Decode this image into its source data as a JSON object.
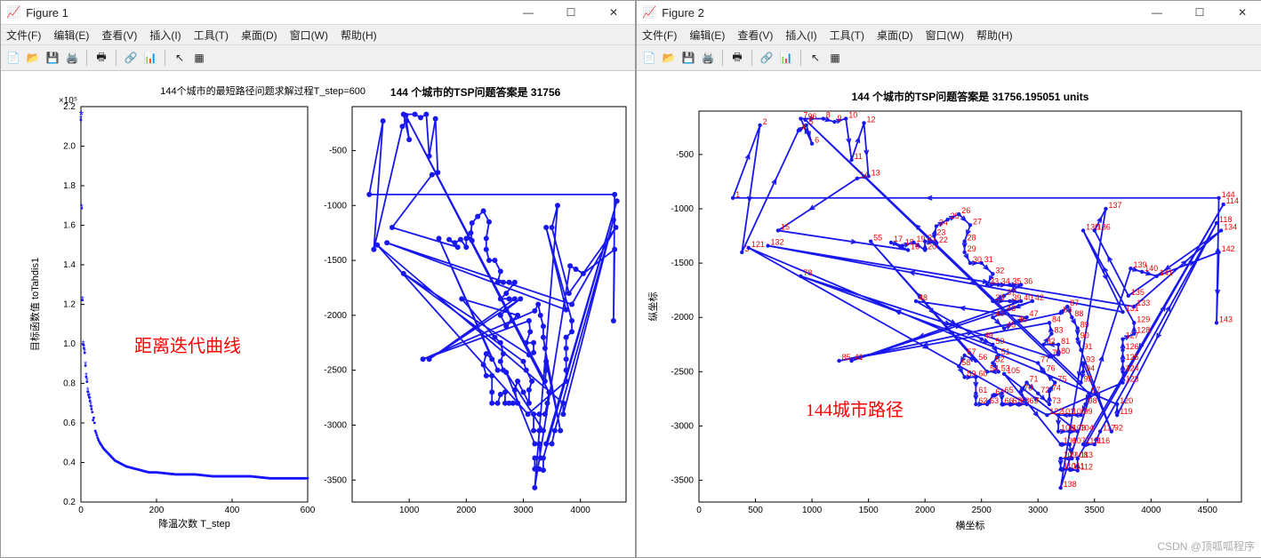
{
  "window1": {
    "title": "Figure 1"
  },
  "window2": {
    "title": "Figure 2"
  },
  "menu": {
    "file": "文件(F)",
    "edit": "编辑(E)",
    "view": "查看(V)",
    "insert": "插入(I)",
    "tools": "工具(T)",
    "desktop": "桌面(D)",
    "window": "窗口(W)",
    "help": "帮助(H)"
  },
  "fig1": {
    "left_title": "144个城市的最短路径问题求解过程T_step=600",
    "left_mult": "×10⁵",
    "left_xlabel": "降温次数 T_step",
    "left_ylabel": "目标函数值 toTahdis1",
    "left_annotation": "距离迭代曲线",
    "right_title": "144 个城市的TSP问题答案是  31756"
  },
  "fig2": {
    "title": "144 个城市的TSP问题答案是  31756.195051 units",
    "xlabel": "横坐标",
    "ylabel": "纵坐标",
    "annotation": "144城市路径"
  },
  "watermark": "CSDN @顶呱呱程序",
  "chart_data": [
    {
      "type": "scatter",
      "title": "144个城市的最短路径问题求解过程T_step=600",
      "xlabel": "降温次数 T_step",
      "ylabel": "目标函数值 toTahdis1 (×10⁵)",
      "xlim": [
        0,
        600
      ],
      "ylim": [
        0.2,
        2.2
      ],
      "x": [
        0,
        5,
        10,
        15,
        20,
        25,
        30,
        35,
        40,
        45,
        50,
        60,
        70,
        80,
        90,
        100,
        120,
        140,
        160,
        180,
        200,
        250,
        300,
        350,
        400,
        450,
        500,
        550,
        600
      ],
      "y": [
        2.15,
        1.0,
        0.95,
        0.8,
        0.75,
        0.7,
        0.65,
        0.6,
        0.55,
        0.52,
        0.5,
        0.47,
        0.45,
        0.43,
        0.41,
        0.4,
        0.38,
        0.37,
        0.36,
        0.35,
        0.35,
        0.34,
        0.34,
        0.33,
        0.33,
        0.33,
        0.32,
        0.32,
        0.32
      ]
    },
    {
      "type": "line",
      "title": "144 个城市的TSP问题答案是  31756",
      "xlim": [
        0,
        5000
      ],
      "ylim": [
        -3700,
        -100
      ],
      "note": "TSP tour preview of 144 cities, coordinates approximate"
    },
    {
      "type": "line",
      "title": "144 个城市的TSP问题答案是  31756.195051 units",
      "xlabel": "横坐标",
      "ylabel": "纵坐标",
      "xlim": [
        0,
        4800
      ],
      "ylim": [
        -3700,
        -100
      ],
      "annotation": "144城市路径",
      "note": "TSP directed tour of 144 cities with arrows and labels"
    }
  ],
  "tsp_cities": [
    [
      300,
      -900
    ],
    [
      540,
      -230
    ],
    [
      380,
      -1400
    ],
    [
      880,
      -280
    ],
    [
      950,
      -230
    ],
    [
      1000,
      -400
    ],
    [
      900,
      -170
    ],
    [
      1100,
      -170
    ],
    [
      1200,
      -200
    ],
    [
      1300,
      -170
    ],
    [
      1350,
      -550
    ],
    [
      1460,
      -210
    ],
    [
      1500,
      -700
    ],
    [
      1400,
      -720
    ],
    [
      700,
      -1200
    ],
    [
      1850,
      -1380
    ],
    [
      1700,
      -1310
    ],
    [
      1800,
      -1340
    ],
    [
      1900,
      -1310
    ],
    [
      2000,
      -1380
    ],
    [
      2000,
      -1300
    ],
    [
      2100,
      -1320
    ],
    [
      2080,
      -1250
    ],
    [
      2100,
      -1160
    ],
    [
      2200,
      -1100
    ],
    [
      2300,
      -1050
    ],
    [
      2400,
      -1150
    ],
    [
      2350,
      -1300
    ],
    [
      2350,
      -1400
    ],
    [
      2400,
      -1500
    ],
    [
      2500,
      -1500
    ],
    [
      2600,
      -1600
    ],
    [
      2550,
      -1700
    ],
    [
      2650,
      -1700
    ],
    [
      2750,
      -1700
    ],
    [
      2850,
      -1700
    ],
    [
      2700,
      -1800
    ],
    [
      2600,
      -1850
    ],
    [
      2750,
      -1850
    ],
    [
      2850,
      -1850
    ],
    [
      1350,
      -2400
    ],
    [
      2950,
      -1850
    ],
    [
      2700,
      -1950
    ],
    [
      2600,
      -2000
    ],
    [
      2700,
      -2100
    ],
    [
      2800,
      -2050
    ],
    [
      2900,
      -2000
    ],
    [
      1920,
      -1850
    ],
    [
      2500,
      -2200
    ],
    [
      2600,
      -2250
    ],
    [
      2650,
      -2350
    ],
    [
      2600,
      -2420
    ],
    [
      2650,
      -2500
    ],
    [
      2550,
      -2500
    ],
    [
      1520,
      -1300
    ],
    [
      2450,
      -2400
    ],
    [
      2350,
      -2350
    ],
    [
      2300,
      -2450
    ],
    [
      2350,
      -2550
    ],
    [
      2450,
      -2550
    ],
    [
      2450,
      -2700
    ],
    [
      2450,
      -2800
    ],
    [
      2550,
      -2800
    ],
    [
      2600,
      -2720
    ],
    [
      2680,
      -2700
    ],
    [
      2680,
      -2800
    ],
    [
      2750,
      -2800
    ],
    [
      2820,
      -2800
    ],
    [
      2900,
      -2800
    ],
    [
      2850,
      -2680
    ],
    [
      2900,
      -2600
    ],
    [
      3000,
      -2700
    ],
    [
      3100,
      -2800
    ],
    [
      3100,
      -2680
    ],
    [
      3150,
      -2600
    ],
    [
      3050,
      -2500
    ],
    [
      3000,
      -2420
    ],
    [
      900,
      -1620
    ],
    [
      3100,
      -2360
    ],
    [
      3180,
      -2340
    ],
    [
      3180,
      -2250
    ],
    [
      3050,
      -2250
    ],
    [
      3120,
      -2150
    ],
    [
      3100,
      -2050
    ],
    [
      1240,
      -2400
    ],
    [
      3200,
      -1960
    ],
    [
      3260,
      -1900
    ],
    [
      3300,
      -2000
    ],
    [
      3350,
      -2100
    ],
    [
      3350,
      -2200
    ],
    [
      3380,
      -2300
    ],
    [
      3650,
      -3050
    ],
    [
      3400,
      -2420
    ],
    [
      3400,
      -2500
    ],
    [
      3380,
      -2600
    ],
    [
      940,
      -180
    ],
    [
      3450,
      -2700
    ],
    [
      3420,
      -2800
    ],
    [
      3380,
      -2900
    ],
    [
      3280,
      -2900
    ],
    [
      3180,
      -2900
    ],
    [
      3180,
      -3050
    ],
    [
      3280,
      -3050
    ],
    [
      3350,
      -3050
    ],
    [
      2700,
      -2520
    ],
    [
      3200,
      -3170
    ],
    [
      3280,
      -3170
    ],
    [
      3300,
      -3300
    ],
    [
      3200,
      -3300
    ],
    [
      3200,
      -3400
    ],
    [
      3280,
      -3400
    ],
    [
      3350,
      -3410
    ],
    [
      3350,
      -3300
    ],
    [
      4640,
      -960
    ],
    [
      3400,
      -3170
    ],
    [
      3500,
      -3170
    ],
    [
      3550,
      -3050
    ],
    [
      4580,
      -1130
    ],
    [
      3700,
      -2900
    ],
    [
      3700,
      -2800
    ],
    [
      440,
      -1360
    ],
    [
      3080,
      -2900
    ],
    [
      3750,
      -2600
    ],
    [
      3750,
      -2500
    ],
    [
      3750,
      -2400
    ],
    [
      3750,
      -2300
    ],
    [
      3750,
      -2200
    ],
    [
      3850,
      -2150
    ],
    [
      3850,
      -2050
    ],
    [
      3400,
      -1200
    ],
    [
      3750,
      -1950
    ],
    [
      610,
      -1340
    ],
    [
      3850,
      -1900
    ],
    [
      4620,
      -1200
    ],
    [
      3800,
      -1800
    ],
    [
      3500,
      -1200
    ],
    [
      3600,
      -1000
    ],
    [
      3200,
      -3570
    ],
    [
      3820,
      -1550
    ],
    [
      3920,
      -1580
    ],
    [
      4050,
      -1620
    ],
    [
      4600,
      -1400
    ],
    [
      4580,
      -2050
    ],
    [
      4600,
      -900
    ]
  ]
}
